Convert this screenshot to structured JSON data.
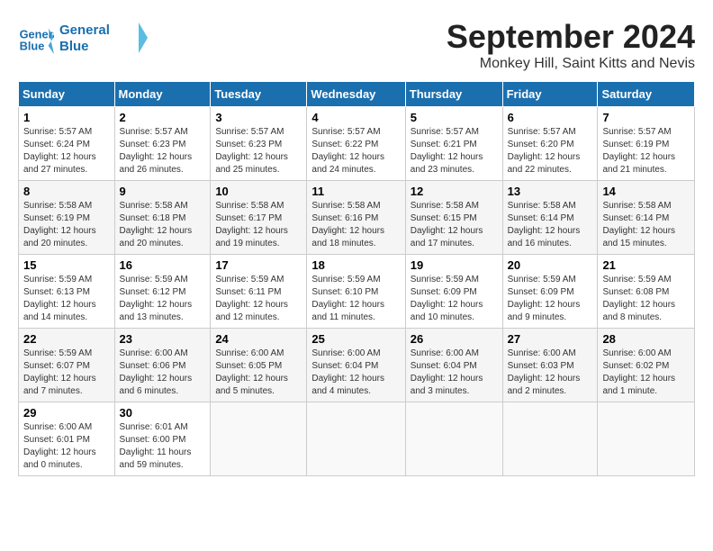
{
  "header": {
    "logo_line1": "General",
    "logo_line2": "Blue",
    "month": "September 2024",
    "location": "Monkey Hill, Saint Kitts and Nevis"
  },
  "columns": [
    "Sunday",
    "Monday",
    "Tuesday",
    "Wednesday",
    "Thursday",
    "Friday",
    "Saturday"
  ],
  "weeks": [
    [
      {
        "day": "1",
        "info": "Sunrise: 5:57 AM\nSunset: 6:24 PM\nDaylight: 12 hours\nand 27 minutes."
      },
      {
        "day": "2",
        "info": "Sunrise: 5:57 AM\nSunset: 6:23 PM\nDaylight: 12 hours\nand 26 minutes."
      },
      {
        "day": "3",
        "info": "Sunrise: 5:57 AM\nSunset: 6:23 PM\nDaylight: 12 hours\nand 25 minutes."
      },
      {
        "day": "4",
        "info": "Sunrise: 5:57 AM\nSunset: 6:22 PM\nDaylight: 12 hours\nand 24 minutes."
      },
      {
        "day": "5",
        "info": "Sunrise: 5:57 AM\nSunset: 6:21 PM\nDaylight: 12 hours\nand 23 minutes."
      },
      {
        "day": "6",
        "info": "Sunrise: 5:57 AM\nSunset: 6:20 PM\nDaylight: 12 hours\nand 22 minutes."
      },
      {
        "day": "7",
        "info": "Sunrise: 5:57 AM\nSunset: 6:19 PM\nDaylight: 12 hours\nand 21 minutes."
      }
    ],
    [
      {
        "day": "8",
        "info": "Sunrise: 5:58 AM\nSunset: 6:19 PM\nDaylight: 12 hours\nand 20 minutes."
      },
      {
        "day": "9",
        "info": "Sunrise: 5:58 AM\nSunset: 6:18 PM\nDaylight: 12 hours\nand 20 minutes."
      },
      {
        "day": "10",
        "info": "Sunrise: 5:58 AM\nSunset: 6:17 PM\nDaylight: 12 hours\nand 19 minutes."
      },
      {
        "day": "11",
        "info": "Sunrise: 5:58 AM\nSunset: 6:16 PM\nDaylight: 12 hours\nand 18 minutes."
      },
      {
        "day": "12",
        "info": "Sunrise: 5:58 AM\nSunset: 6:15 PM\nDaylight: 12 hours\nand 17 minutes."
      },
      {
        "day": "13",
        "info": "Sunrise: 5:58 AM\nSunset: 6:14 PM\nDaylight: 12 hours\nand 16 minutes."
      },
      {
        "day": "14",
        "info": "Sunrise: 5:58 AM\nSunset: 6:14 PM\nDaylight: 12 hours\nand 15 minutes."
      }
    ],
    [
      {
        "day": "15",
        "info": "Sunrise: 5:59 AM\nSunset: 6:13 PM\nDaylight: 12 hours\nand 14 minutes."
      },
      {
        "day": "16",
        "info": "Sunrise: 5:59 AM\nSunset: 6:12 PM\nDaylight: 12 hours\nand 13 minutes."
      },
      {
        "day": "17",
        "info": "Sunrise: 5:59 AM\nSunset: 6:11 PM\nDaylight: 12 hours\nand 12 minutes."
      },
      {
        "day": "18",
        "info": "Sunrise: 5:59 AM\nSunset: 6:10 PM\nDaylight: 12 hours\nand 11 minutes."
      },
      {
        "day": "19",
        "info": "Sunrise: 5:59 AM\nSunset: 6:09 PM\nDaylight: 12 hours\nand 10 minutes."
      },
      {
        "day": "20",
        "info": "Sunrise: 5:59 AM\nSunset: 6:09 PM\nDaylight: 12 hours\nand 9 minutes."
      },
      {
        "day": "21",
        "info": "Sunrise: 5:59 AM\nSunset: 6:08 PM\nDaylight: 12 hours\nand 8 minutes."
      }
    ],
    [
      {
        "day": "22",
        "info": "Sunrise: 5:59 AM\nSunset: 6:07 PM\nDaylight: 12 hours\nand 7 minutes."
      },
      {
        "day": "23",
        "info": "Sunrise: 6:00 AM\nSunset: 6:06 PM\nDaylight: 12 hours\nand 6 minutes."
      },
      {
        "day": "24",
        "info": "Sunrise: 6:00 AM\nSunset: 6:05 PM\nDaylight: 12 hours\nand 5 minutes."
      },
      {
        "day": "25",
        "info": "Sunrise: 6:00 AM\nSunset: 6:04 PM\nDaylight: 12 hours\nand 4 minutes."
      },
      {
        "day": "26",
        "info": "Sunrise: 6:00 AM\nSunset: 6:04 PM\nDaylight: 12 hours\nand 3 minutes."
      },
      {
        "day": "27",
        "info": "Sunrise: 6:00 AM\nSunset: 6:03 PM\nDaylight: 12 hours\nand 2 minutes."
      },
      {
        "day": "28",
        "info": "Sunrise: 6:00 AM\nSunset: 6:02 PM\nDaylight: 12 hours\nand 1 minute."
      }
    ],
    [
      {
        "day": "29",
        "info": "Sunrise: 6:00 AM\nSunset: 6:01 PM\nDaylight: 12 hours\nand 0 minutes."
      },
      {
        "day": "30",
        "info": "Sunrise: 6:01 AM\nSunset: 6:00 PM\nDaylight: 11 hours\nand 59 minutes."
      },
      {
        "day": "",
        "info": ""
      },
      {
        "day": "",
        "info": ""
      },
      {
        "day": "",
        "info": ""
      },
      {
        "day": "",
        "info": ""
      },
      {
        "day": "",
        "info": ""
      }
    ]
  ]
}
